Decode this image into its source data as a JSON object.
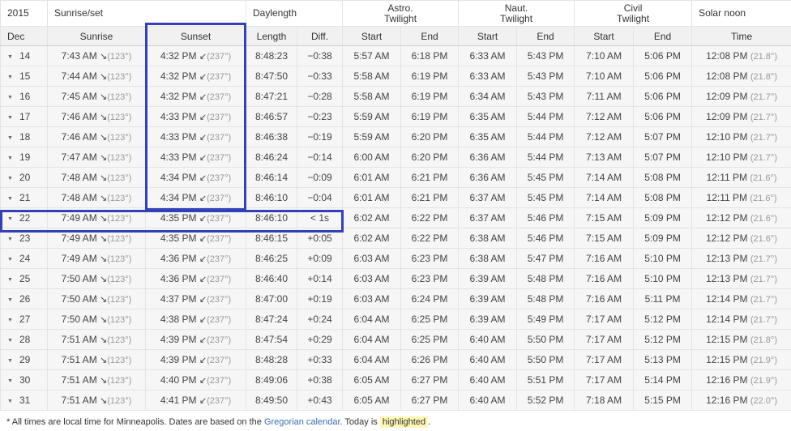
{
  "header": {
    "year": "2015",
    "sunriseset": "Sunrise/set",
    "daylength": "Daylength",
    "astro": "Astro.\nTwilight",
    "naut": "Naut.\nTwilight",
    "civil": "Civil\nTwilight",
    "solarnoon": "Solar noon",
    "month": "Dec",
    "sunrise": "Sunrise",
    "sunset": "Sunset",
    "length": "Length",
    "diff": "Diff.",
    "astro_start": "Start",
    "astro_end": "End",
    "naut_start": "Start",
    "naut_end": "End",
    "civil_start": "Start",
    "civil_end": "End",
    "time": "Time"
  },
  "rows": [
    {
      "day": "14",
      "sunrise": "7:43 AM",
      "sunrise_az": "(123°)",
      "sunset": "4:32 PM",
      "sunset_az": "(237°)",
      "length": "8:48:23",
      "diff": "−0:38",
      "as": "5:57 AM",
      "ae": "6:18 PM",
      "ns": "6:33 AM",
      "ne": "5:43 PM",
      "cs": "7:10 AM",
      "ce": "5:06 PM",
      "noon": "12:08 PM",
      "noon_alt": "(21.8°)"
    },
    {
      "day": "15",
      "sunrise": "7:44 AM",
      "sunrise_az": "(123°)",
      "sunset": "4:32 PM",
      "sunset_az": "(237°)",
      "length": "8:47:50",
      "diff": "−0:33",
      "as": "5:58 AM",
      "ae": "6:19 PM",
      "ns": "6:33 AM",
      "ne": "5:43 PM",
      "cs": "7:10 AM",
      "ce": "5:06 PM",
      "noon": "12:08 PM",
      "noon_alt": "(21.8°)"
    },
    {
      "day": "16",
      "sunrise": "7:45 AM",
      "sunrise_az": "(123°)",
      "sunset": "4:32 PM",
      "sunset_az": "(237°)",
      "length": "8:47:21",
      "diff": "−0:28",
      "as": "5:58 AM",
      "ae": "6:19 PM",
      "ns": "6:34 AM",
      "ne": "5:43 PM",
      "cs": "7:11 AM",
      "ce": "5:06 PM",
      "noon": "12:09 PM",
      "noon_alt": "(21.7°)"
    },
    {
      "day": "17",
      "sunrise": "7:46 AM",
      "sunrise_az": "(123°)",
      "sunset": "4:33 PM",
      "sunset_az": "(237°)",
      "length": "8:46:57",
      "diff": "−0:23",
      "as": "5:59 AM",
      "ae": "6:19 PM",
      "ns": "6:35 AM",
      "ne": "5:44 PM",
      "cs": "7:12 AM",
      "ce": "5:06 PM",
      "noon": "12:09 PM",
      "noon_alt": "(21.7°)"
    },
    {
      "day": "18",
      "sunrise": "7:46 AM",
      "sunrise_az": "(123°)",
      "sunset": "4:33 PM",
      "sunset_az": "(237°)",
      "length": "8:46:38",
      "diff": "−0:19",
      "as": "5:59 AM",
      "ae": "6:20 PM",
      "ns": "6:35 AM",
      "ne": "5:44 PM",
      "cs": "7:12 AM",
      "ce": "5:07 PM",
      "noon": "12:10 PM",
      "noon_alt": "(21.7°)"
    },
    {
      "day": "19",
      "sunrise": "7:47 AM",
      "sunrise_az": "(123°)",
      "sunset": "4:33 PM",
      "sunset_az": "(237°)",
      "length": "8:46:24",
      "diff": "−0:14",
      "as": "6:00 AM",
      "ae": "6:20 PM",
      "ns": "6:36 AM",
      "ne": "5:44 PM",
      "cs": "7:13 AM",
      "ce": "5:07 PM",
      "noon": "12:10 PM",
      "noon_alt": "(21.7°)"
    },
    {
      "day": "20",
      "sunrise": "7:48 AM",
      "sunrise_az": "(123°)",
      "sunset": "4:34 PM",
      "sunset_az": "(237°)",
      "length": "8:46:14",
      "diff": "−0:09",
      "as": "6:01 AM",
      "ae": "6:21 PM",
      "ns": "6:36 AM",
      "ne": "5:45 PM",
      "cs": "7:14 AM",
      "ce": "5:08 PM",
      "noon": "12:11 PM",
      "noon_alt": "(21.6°)"
    },
    {
      "day": "21",
      "sunrise": "7:48 AM",
      "sunrise_az": "(123°)",
      "sunset": "4:34 PM",
      "sunset_az": "(237°)",
      "length": "8:46:10",
      "diff": "−0:04",
      "as": "6:01 AM",
      "ae": "6:21 PM",
      "ns": "6:37 AM",
      "ne": "5:45 PM",
      "cs": "7:14 AM",
      "ce": "5:08 PM",
      "noon": "12:11 PM",
      "noon_alt": "(21.6°)"
    },
    {
      "day": "22",
      "sunrise": "7:49 AM",
      "sunrise_az": "(123°)",
      "sunset": "4:35 PM",
      "sunset_az": "(237°)",
      "length": "8:46:10",
      "diff": "< 1s",
      "as": "6:02 AM",
      "ae": "6:22 PM",
      "ns": "6:37 AM",
      "ne": "5:46 PM",
      "cs": "7:15 AM",
      "ce": "5:09 PM",
      "noon": "12:12 PM",
      "noon_alt": "(21.6°)"
    },
    {
      "day": "23",
      "sunrise": "7:49 AM",
      "sunrise_az": "(123°)",
      "sunset": "4:35 PM",
      "sunset_az": "(237°)",
      "length": "8:46:15",
      "diff": "+0:05",
      "as": "6:02 AM",
      "ae": "6:22 PM",
      "ns": "6:38 AM",
      "ne": "5:46 PM",
      "cs": "7:15 AM",
      "ce": "5:09 PM",
      "noon": "12:12 PM",
      "noon_alt": "(21.6°)"
    },
    {
      "day": "24",
      "sunrise": "7:49 AM",
      "sunrise_az": "(123°)",
      "sunset": "4:36 PM",
      "sunset_az": "(237°)",
      "length": "8:46:25",
      "diff": "+0:09",
      "as": "6:03 AM",
      "ae": "6:23 PM",
      "ns": "6:38 AM",
      "ne": "5:47 PM",
      "cs": "7:16 AM",
      "ce": "5:10 PM",
      "noon": "12:13 PM",
      "noon_alt": "(21.7°)"
    },
    {
      "day": "25",
      "sunrise": "7:50 AM",
      "sunrise_az": "(123°)",
      "sunset": "4:36 PM",
      "sunset_az": "(237°)",
      "length": "8:46:40",
      "diff": "+0:14",
      "as": "6:03 AM",
      "ae": "6:23 PM",
      "ns": "6:39 AM",
      "ne": "5:48 PM",
      "cs": "7:16 AM",
      "ce": "5:10 PM",
      "noon": "12:13 PM",
      "noon_alt": "(21.7°)"
    },
    {
      "day": "26",
      "sunrise": "7:50 AM",
      "sunrise_az": "(123°)",
      "sunset": "4:37 PM",
      "sunset_az": "(237°)",
      "length": "8:47:00",
      "diff": "+0:19",
      "as": "6:03 AM",
      "ae": "6:24 PM",
      "ns": "6:39 AM",
      "ne": "5:48 PM",
      "cs": "7:16 AM",
      "ce": "5:11 PM",
      "noon": "12:14 PM",
      "noon_alt": "(21.7°)"
    },
    {
      "day": "27",
      "sunrise": "7:50 AM",
      "sunrise_az": "(123°)",
      "sunset": "4:38 PM",
      "sunset_az": "(237°)",
      "length": "8:47:24",
      "diff": "+0:24",
      "as": "6:04 AM",
      "ae": "6:25 PM",
      "ns": "6:39 AM",
      "ne": "5:49 PM",
      "cs": "7:17 AM",
      "ce": "5:12 PM",
      "noon": "12:14 PM",
      "noon_alt": "(21.7°)"
    },
    {
      "day": "28",
      "sunrise": "7:51 AM",
      "sunrise_az": "(123°)",
      "sunset": "4:39 PM",
      "sunset_az": "(237°)",
      "length": "8:47:54",
      "diff": "+0:29",
      "as": "6:04 AM",
      "ae": "6:25 PM",
      "ns": "6:40 AM",
      "ne": "5:50 PM",
      "cs": "7:17 AM",
      "ce": "5:12 PM",
      "noon": "12:15 PM",
      "noon_alt": "(21.8°)"
    },
    {
      "day": "29",
      "sunrise": "7:51 AM",
      "sunrise_az": "(123°)",
      "sunset": "4:39 PM",
      "sunset_az": "(237°)",
      "length": "8:48:28",
      "diff": "+0:33",
      "as": "6:04 AM",
      "ae": "6:26 PM",
      "ns": "6:40 AM",
      "ne": "5:50 PM",
      "cs": "7:17 AM",
      "ce": "5:13 PM",
      "noon": "12:15 PM",
      "noon_alt": "(21.9°)"
    },
    {
      "day": "30",
      "sunrise": "7:51 AM",
      "sunrise_az": "(123°)",
      "sunset": "4:40 PM",
      "sunset_az": "(237°)",
      "length": "8:49:06",
      "diff": "+0:38",
      "as": "6:05 AM",
      "ae": "6:27 PM",
      "ns": "6:40 AM",
      "ne": "5:51 PM",
      "cs": "7:17 AM",
      "ce": "5:14 PM",
      "noon": "12:16 PM",
      "noon_alt": "(21.9°)"
    },
    {
      "day": "31",
      "sunrise": "7:51 AM",
      "sunrise_az": "(123°)",
      "sunset": "4:41 PM",
      "sunset_az": "(237°)",
      "length": "8:49:50",
      "diff": "+0:43",
      "as": "6:05 AM",
      "ae": "6:27 PM",
      "ns": "6:40 AM",
      "ne": "5:52 PM",
      "cs": "7:18 AM",
      "ce": "5:15 PM",
      "noon": "12:16 PM",
      "noon_alt": "(22.0°)"
    }
  ],
  "footer": {
    "prefix": "* All times are local time for Minneapolis. Dates are based on the",
    "link": "Gregorian calendar",
    "middle": ". Today is",
    "highlighted": "highlighted",
    "suffix": "."
  },
  "colors": {
    "accent_box": "#3341b6",
    "row_bg": "#f6f6f6",
    "header_bg": "#f1f1f1",
    "link": "#3b6db4",
    "highlight": "#fff7b5"
  },
  "icons": {
    "sunrise_arrow": "sunrise-direction-arrow-icon",
    "sunset_arrow": "sunset-direction-arrow-icon",
    "expand": "expand-triangle-icon"
  }
}
